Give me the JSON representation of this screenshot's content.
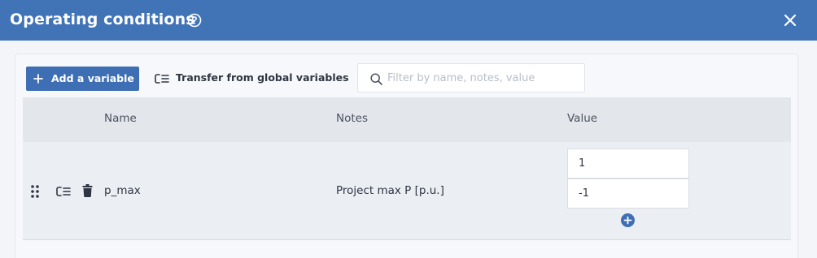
{
  "dialog": {
    "title": "Operating conditions",
    "accent_color": "#4173b7"
  },
  "toolbar": {
    "add_variable_label": "Add a variable",
    "transfer_label": "Transfer from global variables",
    "search_placeholder": "Filter by name, notes, value",
    "search_value": ""
  },
  "table": {
    "columns": [
      "Name",
      "Notes",
      "Value"
    ],
    "rows": [
      {
        "name": "p_max",
        "notes": "Project max P [p.u.]",
        "values": [
          "1",
          "-1"
        ]
      }
    ]
  },
  "icons": [
    "help-icon",
    "close-icon",
    "plus-icon",
    "transfer-icon",
    "search-icon",
    "drag-handle-icon",
    "trash-icon",
    "add-value-icon"
  ]
}
